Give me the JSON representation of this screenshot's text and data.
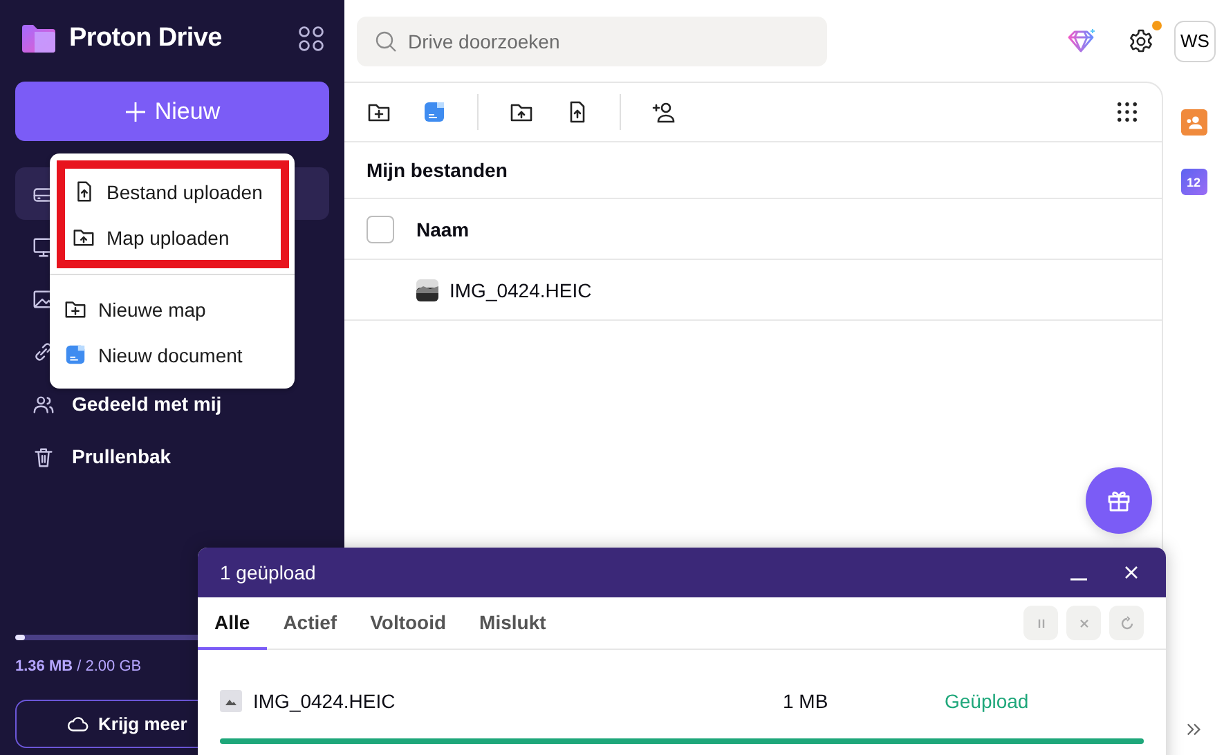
{
  "app": {
    "title": "Proton Drive"
  },
  "new_button": {
    "label": "Nieuw"
  },
  "new_menu": {
    "items": [
      {
        "kind": "upload-file",
        "label": "Bestand uploaden",
        "highlighted": true
      },
      {
        "kind": "upload-folder",
        "label": "Map uploaden",
        "highlighted": true
      },
      {
        "kind": "new-folder",
        "label": "Nieuwe map",
        "highlighted": false
      },
      {
        "kind": "new-document",
        "label": "Nieuw document",
        "highlighted": false
      }
    ]
  },
  "sidebar": {
    "items": [
      {
        "kind": "drive",
        "selected": true
      },
      {
        "kind": "computer",
        "selected": false
      },
      {
        "kind": "photo",
        "selected": false
      },
      {
        "kind": "link",
        "selected": false
      },
      {
        "kind": "people",
        "label": "Gedeeld met mij",
        "selected": false
      },
      {
        "kind": "trash",
        "label": "Prullenbak",
        "selected": false
      }
    ]
  },
  "storage": {
    "used": "1.36 MB",
    "total": " / 2.00 GB",
    "level": 0.03
  },
  "get_more_button": {
    "label": "Krijg meer"
  },
  "search": {
    "placeholder": "Drive doorzoeken"
  },
  "avatar": {
    "initials": "WS"
  },
  "breadcrumb": "Mijn bestanden",
  "table": {
    "select_all_checked": false,
    "columns": [
      "Naam"
    ],
    "rows": [
      {
        "name": "IMG_0424.HEIC",
        "selected": false
      }
    ]
  },
  "calendar_badge": "12",
  "upload_panel": {
    "title": "1 geüpload",
    "tabs": [
      {
        "label": "Alle",
        "selected": true
      },
      {
        "label": "Actief",
        "selected": false
      },
      {
        "label": "Voltooid",
        "selected": false
      },
      {
        "label": "Mislukt",
        "selected": false
      }
    ],
    "items": [
      {
        "name": "IMG_0424.HEIC",
        "size": "1 MB",
        "status": "Geüpload",
        "level": 1
      }
    ]
  }
}
